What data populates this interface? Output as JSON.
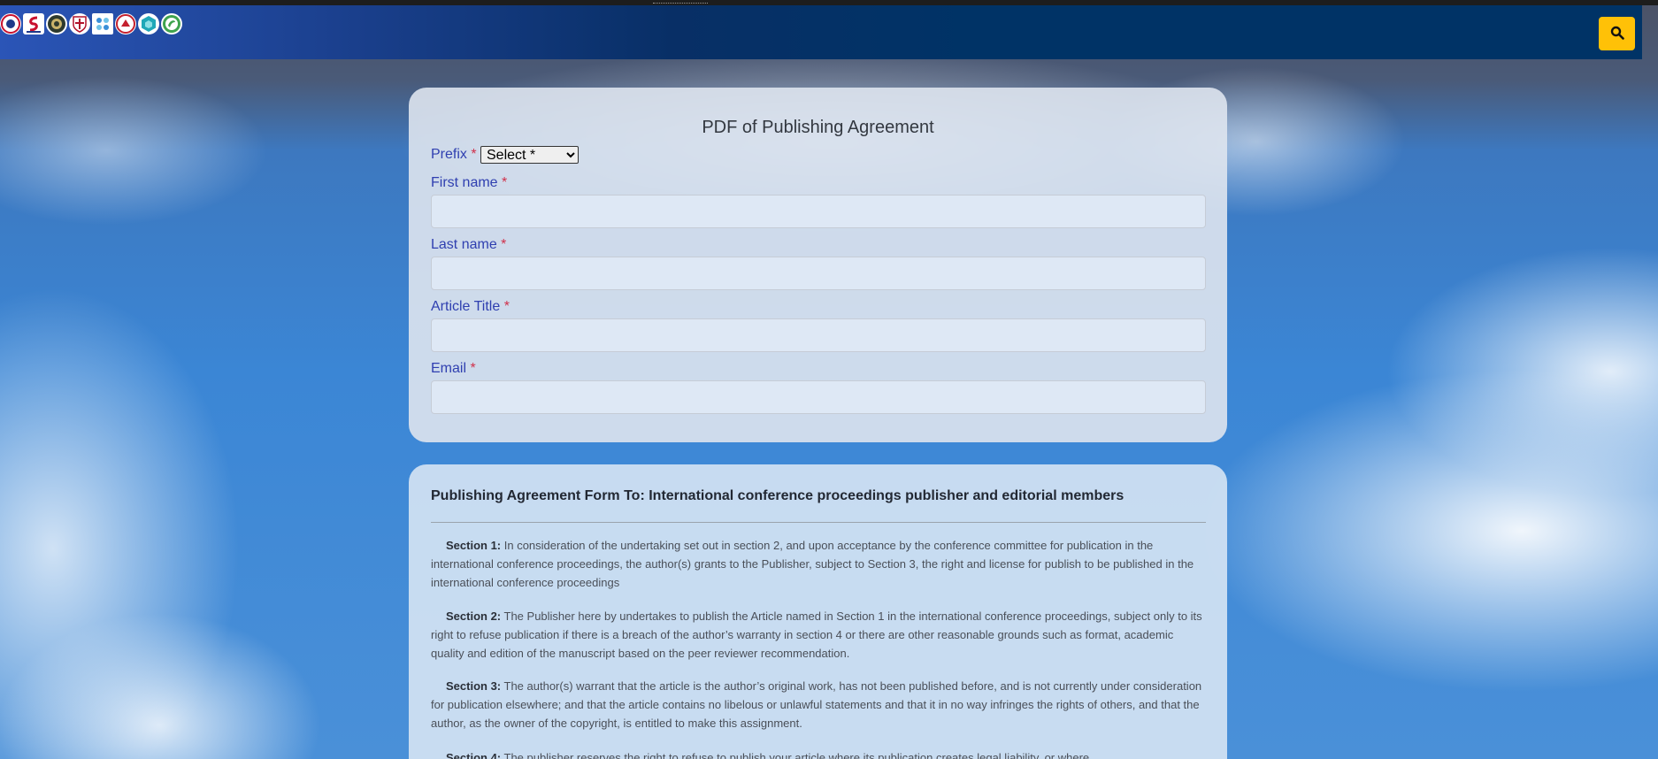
{
  "navbar": {
    "logos": [
      {
        "name": "logo-1-icon",
        "color": "#c8102e"
      },
      {
        "name": "logo-2-icon",
        "color": "#1e3a8a"
      },
      {
        "name": "logo-3-icon",
        "color": "#2d3a2e"
      },
      {
        "name": "logo-4-icon",
        "color": "#b0122a"
      },
      {
        "name": "logo-5-icon",
        "color": "#3a8fd8"
      },
      {
        "name": "logo-6-icon",
        "color": "#c4202e"
      },
      {
        "name": "logo-7-icon",
        "color": "#20a8b8"
      },
      {
        "name": "logo-8-icon",
        "color": "#3fa34d"
      }
    ],
    "search_icon": "search-icon",
    "search_color": "#ffc107"
  },
  "form": {
    "title": "PDF of Publishing Agreement",
    "required_mark": "*",
    "prefix_label": "Prefix",
    "prefix_selected": "Select *",
    "first_name_label": "First name",
    "last_name_label": "Last name",
    "article_title_label": "Article Title",
    "email_label": "Email"
  },
  "agreement": {
    "title": "Publishing Agreement Form To: International conference proceedings publisher and editorial members",
    "sections": [
      {
        "heading": "Section 1:",
        "text": "In consideration of the undertaking set out in section 2, and upon acceptance by the conference committee for publication in the international conference proceedings, the author(s) grants to the Publisher, subject to Section 3, the right and license for publish to be published in the international conference proceedings"
      },
      {
        "heading": "Section 2:",
        "text": "The Publisher here by undertakes to publish the Article named in Section 1 in the international conference proceedings, subject only to its right to refuse publication if there is a breach of the author’s warranty in section 4 or there are other reasonable grounds such as format, academic quality and edition of the manuscript based on the peer reviewer recommendation."
      },
      {
        "heading": "Section 3:",
        "text": "The author(s) warrant that the article is the author’s original work, has not been published before, and is not currently under consideration for publication elsewhere; and that the article contains no libelous or unlawful statements and that it in no way infringes the rights of others, and that the author, as the owner of the copyright, is entitled to make this assignment."
      },
      {
        "heading": "Section 4:",
        "text": "The publisher reserves the right to refuse to publish your article where its publication creates legal liability, or where"
      }
    ]
  }
}
